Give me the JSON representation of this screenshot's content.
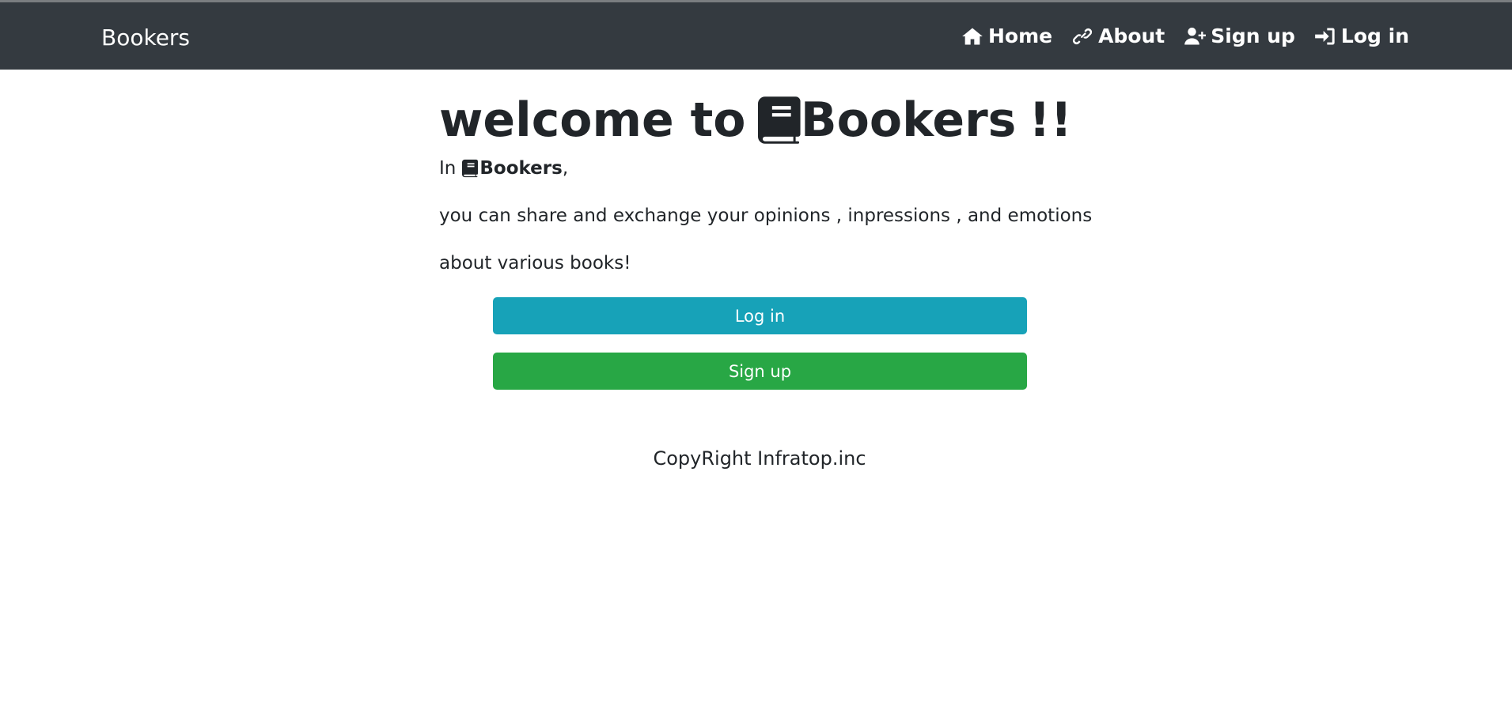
{
  "navbar": {
    "brand": "Bookers",
    "links": [
      {
        "label": "Home",
        "icon": "home-icon"
      },
      {
        "label": "About",
        "icon": "link-icon"
      },
      {
        "label": "Sign up",
        "icon": "user-plus-icon"
      },
      {
        "label": "Log in",
        "icon": "sign-in-icon"
      }
    ]
  },
  "main": {
    "headline_prefix": "welcome to",
    "headline_brand": "Bookers",
    "headline_suffix": "!!",
    "intro_prefix": "In",
    "intro_brand": "Bookers",
    "intro_suffix": ",",
    "line2": "you can share and exchange your opinions , inpressions , and emotions",
    "line3": "about various books!",
    "login_button": "Log in",
    "signup_button": "Sign up"
  },
  "footer": {
    "text": "CopyRight Infratop.inc"
  },
  "colors": {
    "navbar_bg": "#343a40",
    "login_button_bg": "#17a2b8",
    "signup_button_bg": "#28a745",
    "text": "#212529"
  }
}
